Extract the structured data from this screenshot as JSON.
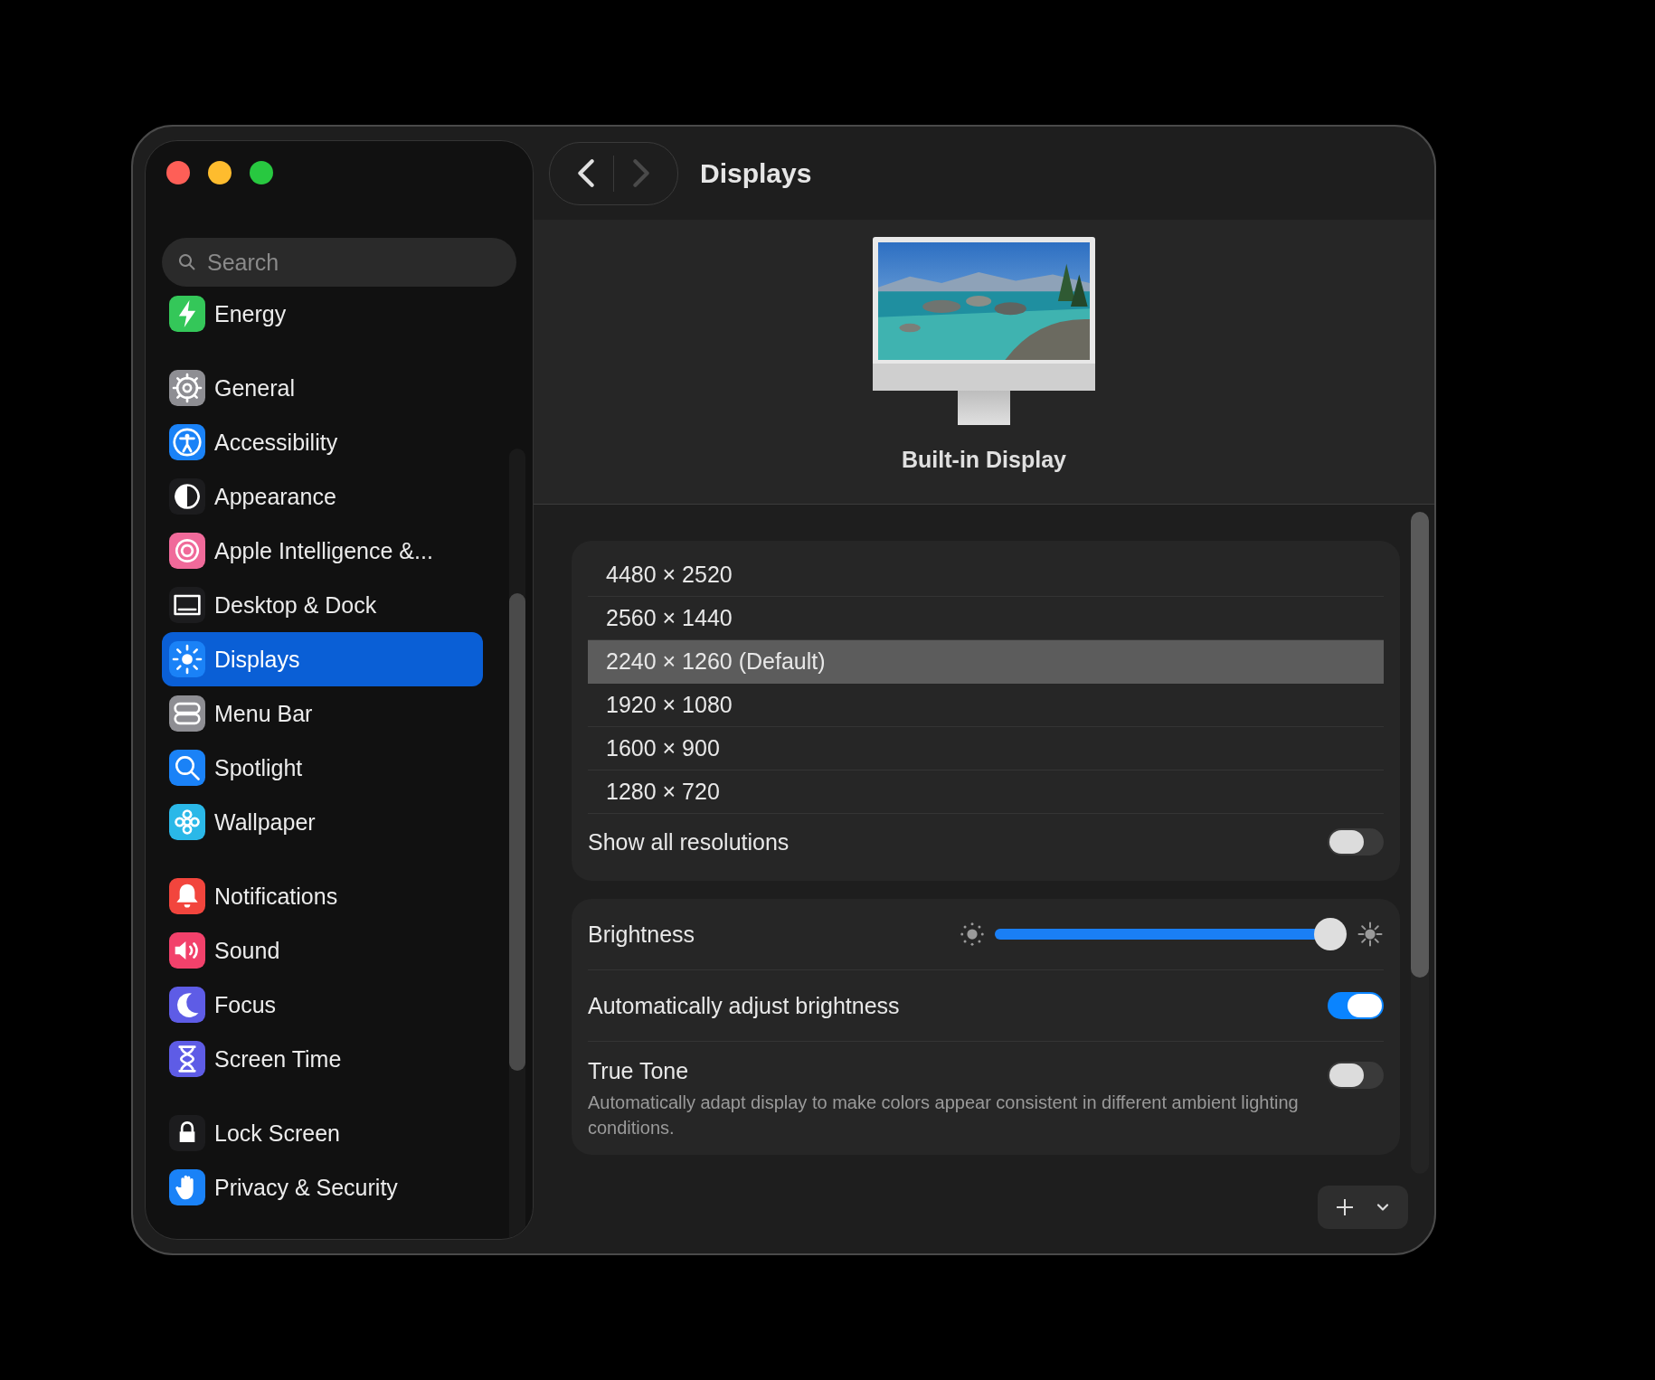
{
  "window": {
    "title": "Displays"
  },
  "nav": [
    {
      "kind": "back",
      "disabled": false
    },
    {
      "kind": "forward",
      "disabled": true
    }
  ],
  "search": {
    "placeholder": "Search"
  },
  "sidebar": {
    "groups": [
      [
        {
          "label": "Energy",
          "kind": "energy",
          "selected": false
        }
      ],
      [
        {
          "label": "General",
          "kind": "general",
          "selected": false
        },
        {
          "label": "Accessibility",
          "kind": "accessibility",
          "selected": false
        },
        {
          "label": "Appearance",
          "kind": "appearance",
          "selected": false
        },
        {
          "label": "Apple Intelligence &...",
          "kind": "apple_intelligence",
          "selected": false
        },
        {
          "label": "Desktop & Dock",
          "kind": "desktop_dock",
          "selected": false
        },
        {
          "label": "Displays",
          "kind": "displays",
          "selected": true
        },
        {
          "label": "Menu Bar",
          "kind": "menu_bar",
          "selected": false
        },
        {
          "label": "Spotlight",
          "kind": "spotlight",
          "selected": false
        },
        {
          "label": "Wallpaper",
          "kind": "wallpaper",
          "selected": false
        }
      ],
      [
        {
          "label": "Notifications",
          "kind": "notifications",
          "selected": false
        },
        {
          "label": "Sound",
          "kind": "sound",
          "selected": false
        },
        {
          "label": "Focus",
          "kind": "focus",
          "selected": false
        },
        {
          "label": "Screen Time",
          "kind": "screen_time",
          "selected": false
        }
      ],
      [
        {
          "label": "Lock Screen",
          "kind": "lock_screen",
          "selected": false
        },
        {
          "label": "Privacy & Security",
          "kind": "privacy",
          "selected": false
        }
      ]
    ]
  },
  "display": {
    "name": "Built-in Display"
  },
  "resolutions": [
    {
      "label": "4480 × 2520",
      "selected": false
    },
    {
      "label": "2560 × 1440",
      "selected": false
    },
    {
      "label": "2240 × 1260 (Default)",
      "selected": true
    },
    {
      "label": "1920 × 1080",
      "selected": false
    },
    {
      "label": "1600 × 900",
      "selected": false
    },
    {
      "label": "1280 × 720",
      "selected": false
    }
  ],
  "show_all_resolutions": {
    "label": "Show all resolutions",
    "on": false
  },
  "brightness": {
    "label": "Brightness",
    "level": 0.95
  },
  "auto_brightness": {
    "label": "Automatically adjust brightness",
    "on": true
  },
  "true_tone": {
    "label": "True Tone",
    "description": "Automatically adapt display to make colors appear consistent in different ambient lighting conditions.",
    "on": false
  }
}
